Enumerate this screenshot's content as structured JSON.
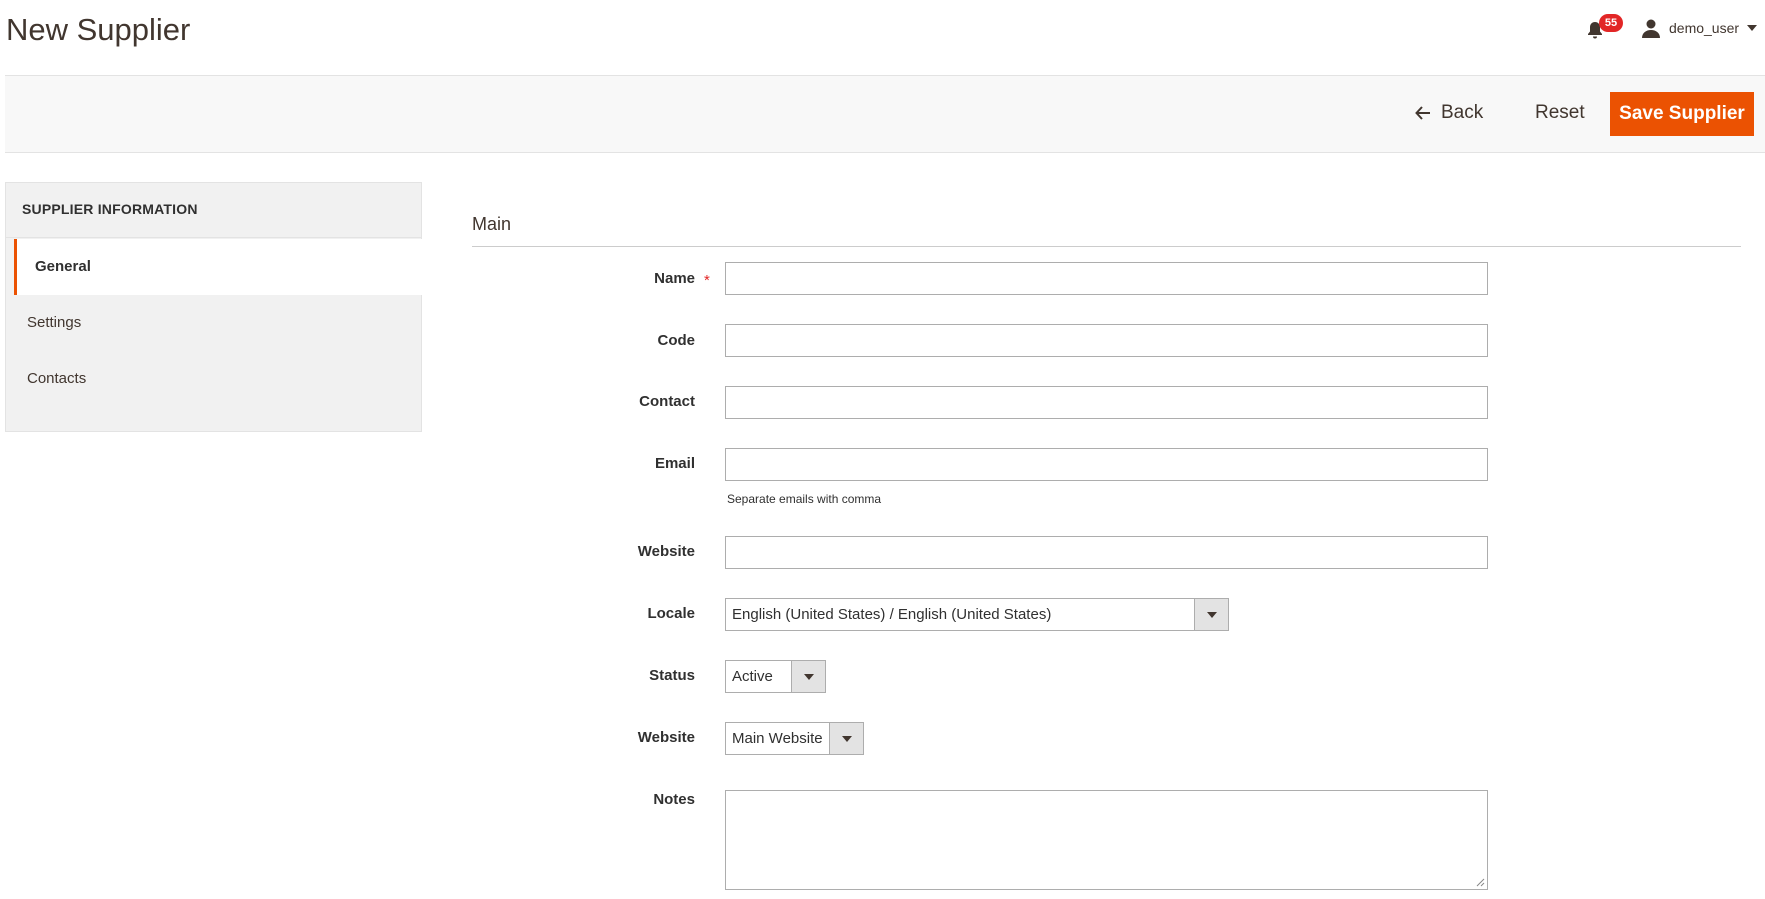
{
  "header": {
    "title": "New Supplier",
    "notifications_count": "55",
    "user_name": "demo_user"
  },
  "actions": {
    "back_label": "Back",
    "reset_label": "Reset",
    "save_label": "Save Supplier"
  },
  "sidebar": {
    "title": "SUPPLIER INFORMATION",
    "items": [
      {
        "label": "General",
        "active": true
      },
      {
        "label": "Settings",
        "active": false
      },
      {
        "label": "Contacts",
        "active": false
      }
    ]
  },
  "form": {
    "section_title": "Main",
    "name_label": "Name",
    "required_marker": "*",
    "code_label": "Code",
    "contact_label": "Contact",
    "email_label": "Email",
    "email_note": "Separate emails with comma",
    "website_label": "Website",
    "locale_label": "Locale",
    "locale_value": "English (United States) / English (United States)",
    "status_label": "Status",
    "status_value": "Active",
    "website_select_label": "Website",
    "website_select_value": "Main Website",
    "notes_label": "Notes"
  },
  "colors": {
    "accent": "#eb5202",
    "badge": "#e22626",
    "text": "#303030"
  }
}
